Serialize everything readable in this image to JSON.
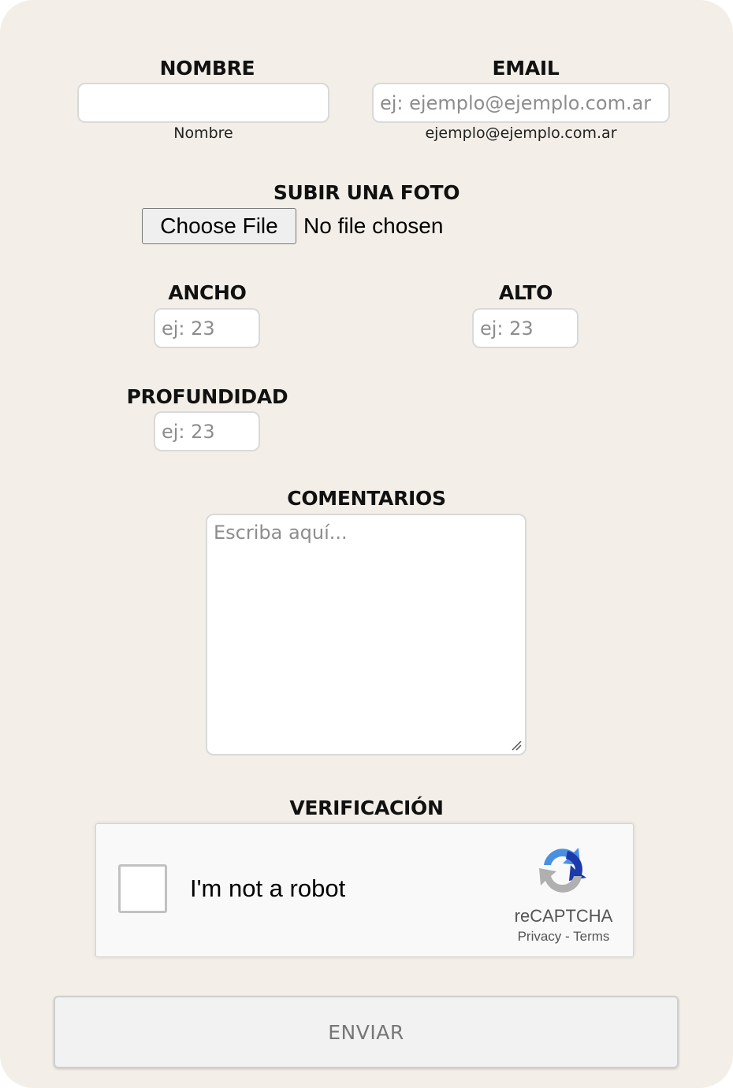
{
  "form": {
    "nombre": {
      "label": "NOMBRE",
      "value": "",
      "hint": "Nombre"
    },
    "email": {
      "label": "EMAIL",
      "placeholder": "ej: ejemplo@ejemplo.com.ar",
      "hint": "ejemplo@ejemplo.com.ar"
    },
    "foto": {
      "label": "SUBIR UNA FOTO",
      "button_label": "Choose File",
      "status": "No file chosen"
    },
    "ancho": {
      "label": "ANCHO",
      "placeholder": "ej: 23"
    },
    "alto": {
      "label": "ALTO",
      "placeholder": "ej: 23"
    },
    "profundidad": {
      "label": "PROFUNDIDAD",
      "placeholder": "ej: 23"
    },
    "comentarios": {
      "label": "COMENTARIOS",
      "placeholder": "Escriba aquí..."
    },
    "verificacion": {
      "label": "VERIFICACIÓN",
      "checkbox_text": "I'm not a robot",
      "brand": "reCAPTCHA",
      "privacy_link": "Privacy",
      "separator": "-",
      "terms_link": "Terms",
      "icon": "recaptcha-logo"
    },
    "submit_label": "ENVIAR"
  },
  "colors": {
    "card_background": "#f3efe8",
    "input_border": "#d9d9d9",
    "recaptcha_blue": "#1c3aa9",
    "recaptcha_light_blue": "#4a90e2",
    "recaptcha_gray": "#b0b0b0"
  }
}
